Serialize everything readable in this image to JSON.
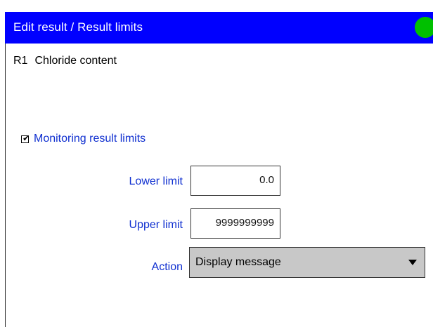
{
  "window": {
    "title": "Edit result / Result limits",
    "title_bar_color": "#0000ff",
    "status_indicator": {
      "icon": "status-dot-icon",
      "color": "#00c000"
    }
  },
  "result": {
    "id": "R1",
    "name": "Chloride content"
  },
  "monitoring": {
    "checked": true,
    "label": "Monitoring result limits"
  },
  "fields": {
    "lower_limit": {
      "label": "Lower limit",
      "value": "0.0"
    },
    "upper_limit": {
      "label": "Upper limit",
      "value": "9999999999"
    },
    "action": {
      "label": "Action",
      "selected": "Display message"
    }
  },
  "colors": {
    "label_blue": "#1030d0",
    "dropdown_bg": "#c8c8c8"
  }
}
